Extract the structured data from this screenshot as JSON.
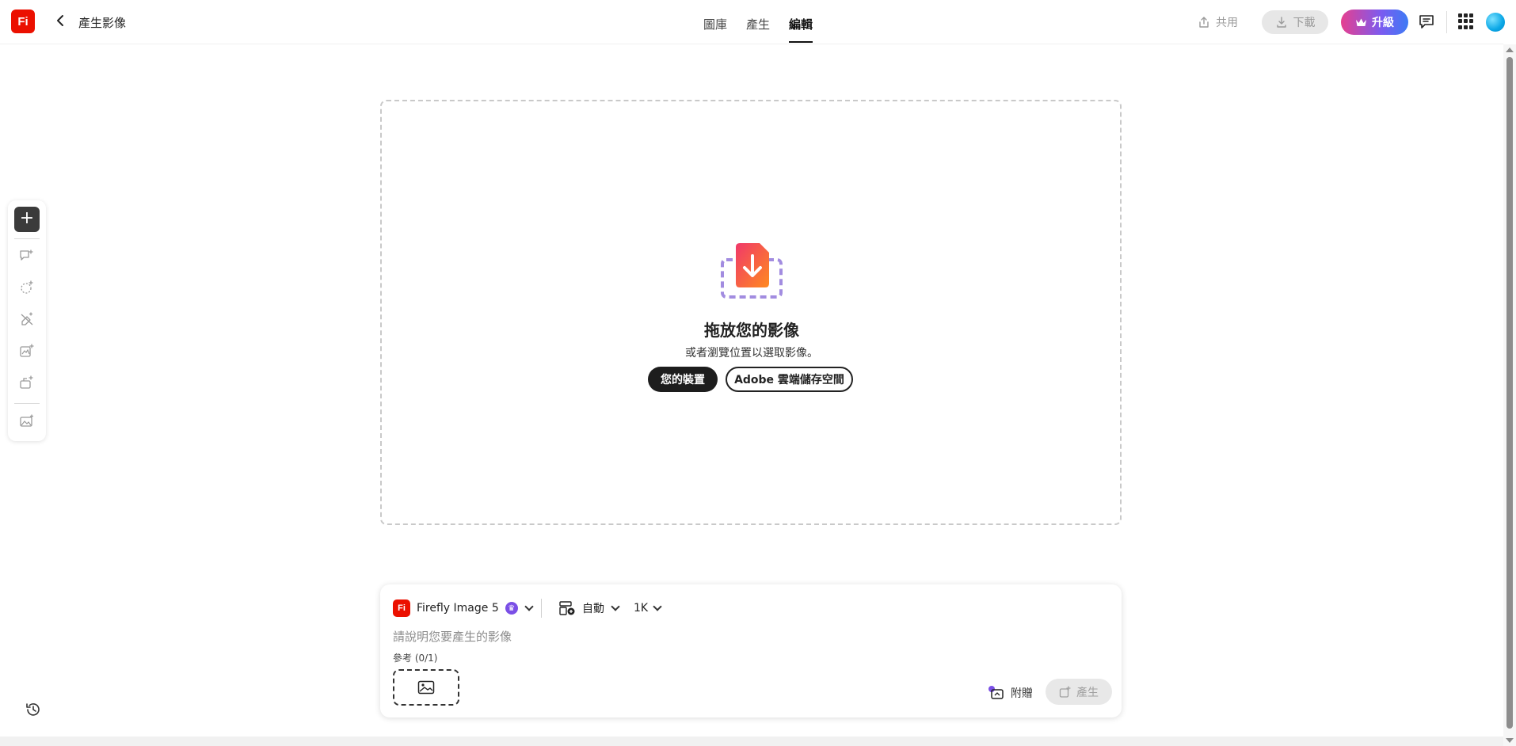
{
  "header": {
    "logo": "Fi",
    "page_title": "產生影像",
    "tabs": [
      {
        "label": "圖庫"
      },
      {
        "label": "產生"
      },
      {
        "label": "編輯"
      }
    ],
    "share_label": "共用",
    "download_label": "下載",
    "upgrade_label": "升級"
  },
  "dropzone": {
    "title": "拖放您的影像",
    "subtitle": "或者瀏覽位置以選取影像。",
    "device_button": "您的裝置",
    "cloud_button": "Adobe 雲端儲存空間"
  },
  "prompt": {
    "model_logo": "Fi",
    "model_name": "Firefly Image 5",
    "aspect": "自動",
    "resolution": "1K",
    "placeholder": "請說明您要產生的影像",
    "reference_label": "參考 (0/1)",
    "attach_label": "附贈",
    "generate_label": "產生"
  },
  "colors": {
    "brand": "#eb1000",
    "upgrade_gradient": [
      "#e63f8f",
      "#7b5bf0",
      "#3d7bf5"
    ],
    "primary_button": "#1d1d1d"
  },
  "icons": {
    "left_toolbar": [
      "add-icon",
      "text-prompt-icon",
      "remove-background-icon",
      "erase-icon",
      "generative-fill-icon",
      "expand-icon",
      "reference-image-icon"
    ]
  }
}
